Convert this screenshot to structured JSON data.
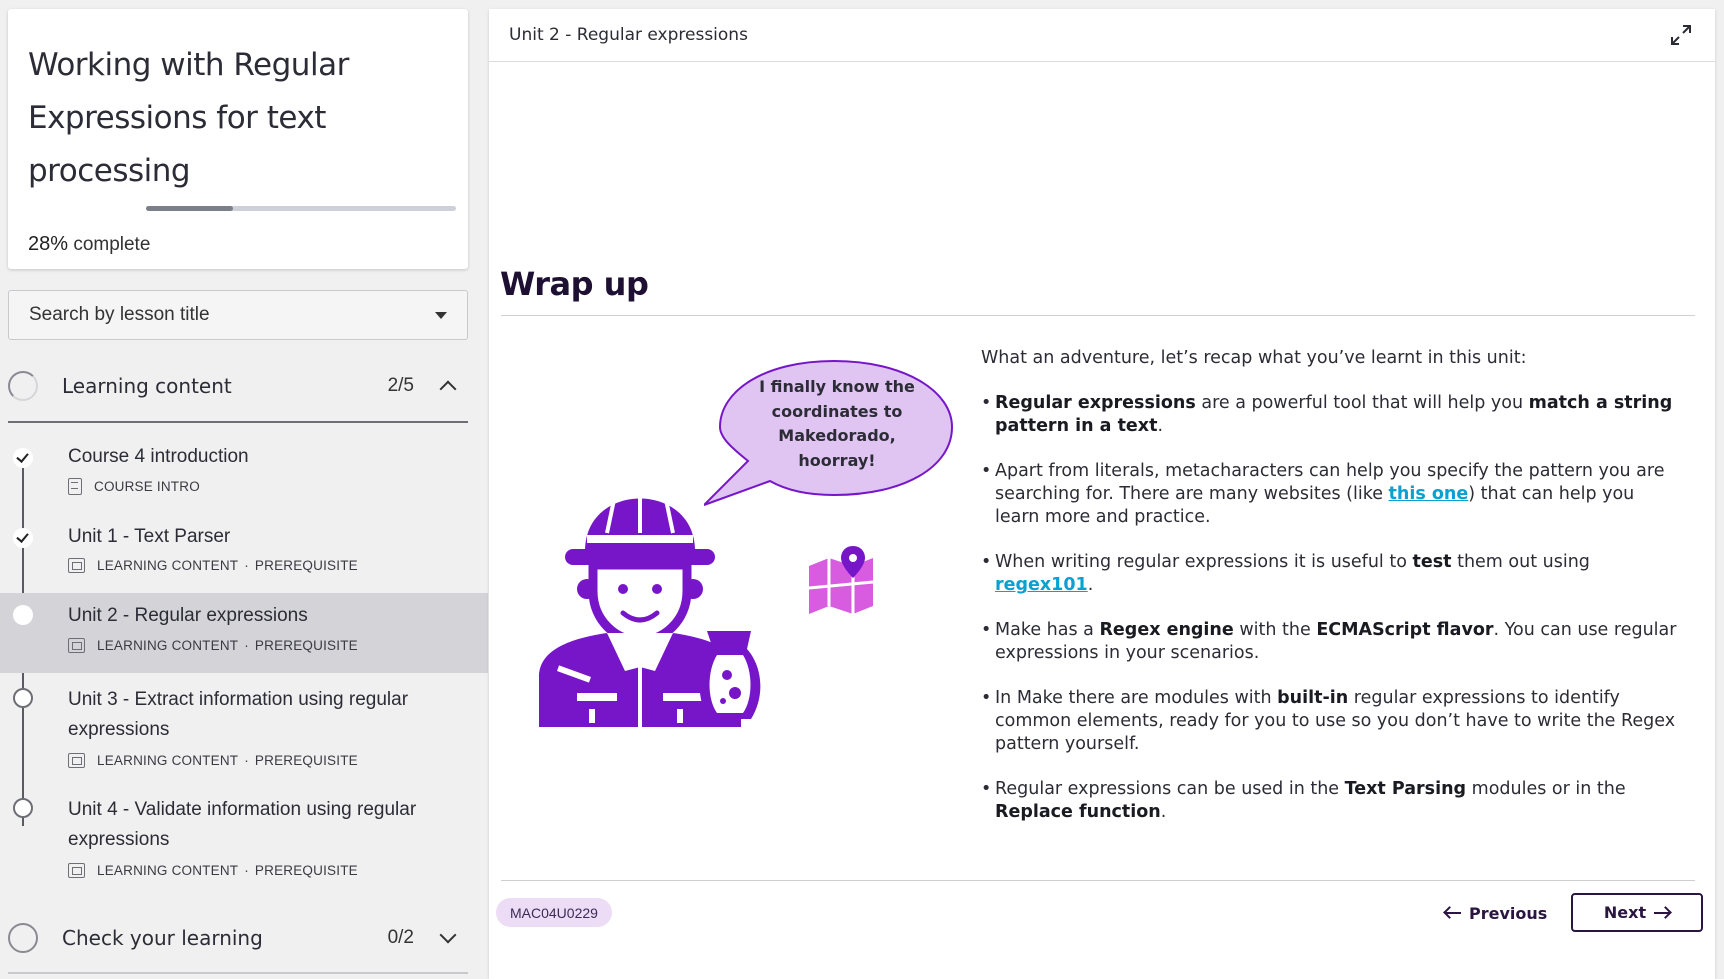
{
  "course": {
    "title": "Working with Regular Expressions for text processing",
    "progress_percent": 28,
    "progress_value": "28%",
    "progress_suffix": "complete"
  },
  "search": {
    "label": "Search by lesson title"
  },
  "sections": [
    {
      "title": "Learning content",
      "count": "2/5",
      "expanded": true
    },
    {
      "title": "Check your learning",
      "count": "0/2",
      "expanded": false
    }
  ],
  "lessons": [
    {
      "title": "Course 4 introduction",
      "type": "COURSE INTRO",
      "tag": "",
      "status": "done",
      "icon": "document-icon"
    },
    {
      "title": "Unit 1 - Text Parser",
      "type": "LEARNING CONTENT",
      "tag": "PREREQUISITE",
      "status": "done",
      "icon": "screen-icon"
    },
    {
      "title": "Unit 2 - Regular expressions",
      "type": "LEARNING CONTENT",
      "tag": "PREREQUISITE",
      "status": "current",
      "icon": "screen-icon"
    },
    {
      "title": "Unit 3 - Extract information using regular expressions",
      "type": "LEARNING CONTENT",
      "tag": "PREREQUISITE",
      "status": "todo",
      "icon": "screen-icon"
    },
    {
      "title": "Unit 4 - Validate information using regular expressions",
      "type": "LEARNING CONTENT",
      "tag": "PREREQUISITE",
      "status": "todo",
      "icon": "screen-icon"
    }
  ],
  "meta_separator": "·",
  "panel": {
    "title": "Unit 2 - Regular expressions",
    "heading": "Wrap up",
    "bubble": "I finally know the coordinates to Makedorado, hoorray!",
    "intro": "What an adventure, let’s recap what you’ve learnt in this unit:",
    "bullets": {
      "b1": {
        "s1": "Regular expressions",
        "t1": " are a powerful tool that will help you ",
        "s2": "match a string pattern in a text",
        "t2": "."
      },
      "b2": {
        "t1": "Apart from literals, metacharacters can help you specify the pattern you are searching for. There are many websites (like ",
        "link": "this one",
        "t2": ") that can help you learn more and practice."
      },
      "b3": {
        "t1": "When writing regular expressions it is useful to ",
        "s1": "test",
        "t2": " them out using ",
        "link": "regex101",
        "t3": "."
      },
      "b4": {
        "t1": "Make has a ",
        "s1": "Regex engine",
        "t2": " with the ",
        "s2": "ECMAScript flavor",
        "t3": ". You can use regular expressions in your scenarios."
      },
      "b5": {
        "t1": "In Make there are modules with ",
        "s1": "built-in",
        "t2": " regular expressions to identify common elements, ready for you to use so you don’t have to write the Regex pattern yourself."
      },
      "b6": {
        "t1": "Regular expressions can be used in the ",
        "s1": "Text Parsing",
        "t2": " modules or in the ",
        "s2": "Replace function",
        "t3": "."
      }
    },
    "code": "MAC04U0229",
    "prev_label": "Previous",
    "next_label": "Next"
  },
  "colors": {
    "illustration": "#7716c9",
    "bubble_fill": "#e0c4f2",
    "map": "#d75ce0",
    "link": "#0aa0d0",
    "nav_button": "#2a1640",
    "badge_bg": "#ecdcf6"
  }
}
